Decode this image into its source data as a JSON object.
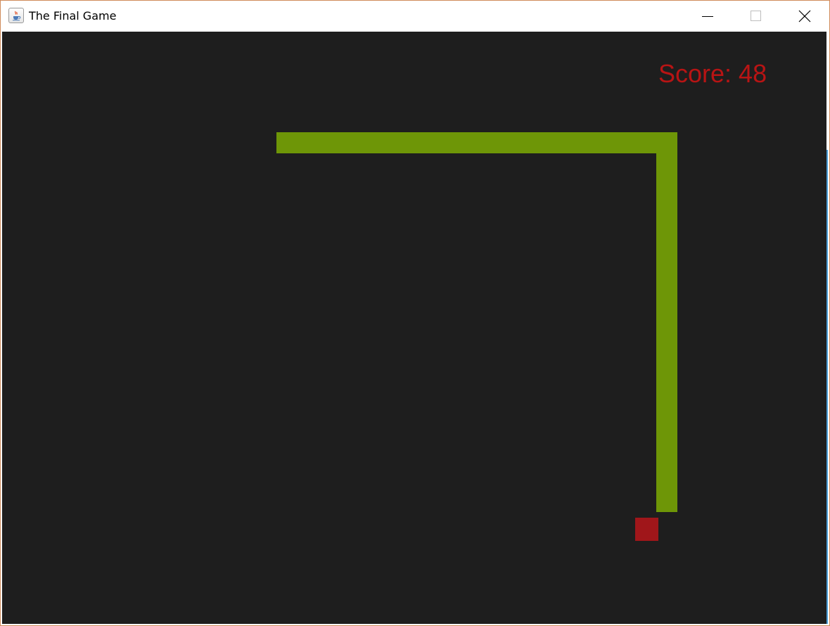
{
  "window": {
    "title": "The Final Game",
    "icon": "java-cup-icon",
    "controls": {
      "minimize_icon": "minimize-icon",
      "maximize_icon": "maximize-icon",
      "close_icon": "close-icon"
    }
  },
  "game": {
    "score_text": "Score: 48",
    "score": 48,
    "colors": {
      "background": "#1e1e1e",
      "snake": "#6e9607",
      "food": "#a0161a",
      "score_text": "#b81414"
    }
  }
}
